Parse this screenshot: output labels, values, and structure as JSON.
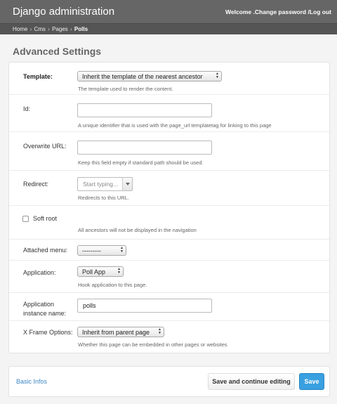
{
  "header": {
    "brand": "Django administration",
    "welcome": "Welcome ",
    "change_password": ".Change password",
    "sep": " /",
    "logout": "Log out"
  },
  "breadcrumbs": [
    {
      "label": "Home"
    },
    {
      "label": "Cms"
    },
    {
      "label": "Pages"
    },
    {
      "label": "Polls"
    }
  ],
  "breadcrumb_sep": "›",
  "page_title": "Advanced Settings",
  "form": {
    "template": {
      "label": "Template:",
      "value": "Inherit the template of the nearest ancestor",
      "help": "The template used to render the content."
    },
    "id": {
      "label": "Id:",
      "value": "",
      "help": "A unique identifier that is used with the page_url templatetag for linking to this page"
    },
    "overwrite_url": {
      "label": "Overwrite URL:",
      "value": "",
      "help": "Keep this field empty if standard path should be used."
    },
    "redirect": {
      "label": "Redirect:",
      "placeholder": "Start typing...",
      "help": "Redirects to this URL."
    },
    "soft_root": {
      "label": "Soft root",
      "checked": false,
      "help": "All ancestors will not be displayed in the navigation"
    },
    "attached_menu": {
      "label": "Attached menu:",
      "value": "---------"
    },
    "application": {
      "label": "Application:",
      "value": "Poll App",
      "help": "Hook application to this page."
    },
    "application_instance": {
      "label_line1": "Application",
      "label_line2": "instance name:",
      "value": "polls"
    },
    "x_frame_options": {
      "label": "X Frame Options:",
      "value": "Inherit from parent page",
      "help": "Whether this page can be embedded in other pages or websites"
    }
  },
  "footer": {
    "basic_infos": "Basic Infos",
    "save_continue": "Save and continue editing",
    "save": "Save"
  },
  "colors": {
    "header_bg": "#666666",
    "breadcrumb_bg": "#555555",
    "link": "#3e88c5",
    "save_button": "#3aa0e0"
  }
}
